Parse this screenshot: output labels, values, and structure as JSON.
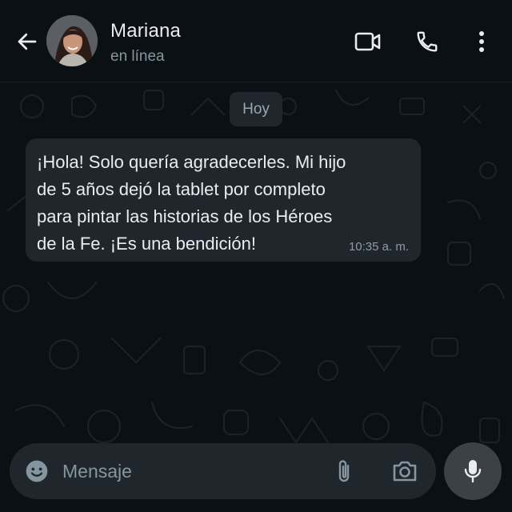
{
  "header": {
    "contact_name": "Mariana",
    "contact_status": "en línea",
    "back_icon": "arrow-left-icon",
    "video_icon": "video-camera-icon",
    "call_icon": "phone-icon",
    "menu_icon": "more-vertical-icon"
  },
  "chat": {
    "date_label": "Hoy",
    "messages": [
      {
        "text": "¡Hola! Solo quería agradecerles. Mi hijo\nde 5 años dejó la tablet por completo\npara pintar las historias de los Héroes\nde la Fe. ¡Es una bendición!",
        "time": "10:35 a. m.",
        "direction": "incoming"
      }
    ]
  },
  "composer": {
    "placeholder": "Mensaje",
    "value": "",
    "emoji_icon": "emoji-icon",
    "attach_icon": "paperclip-icon",
    "camera_icon": "camera-icon",
    "mic_icon": "microphone-icon"
  },
  "colors": {
    "background": "#0b1014",
    "bubble": "#1f272c",
    "primary_text": "#e9edef",
    "secondary_text": "#8696a0",
    "mic_button": "#3b4145"
  }
}
